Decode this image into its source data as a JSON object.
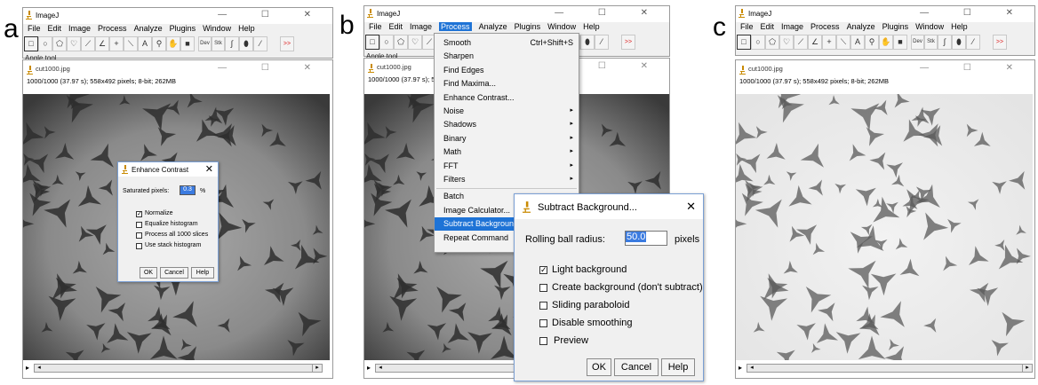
{
  "panel_labels": [
    "a",
    "b",
    "c"
  ],
  "app": {
    "title": "ImageJ",
    "menus": [
      "File",
      "Edit",
      "Image",
      "Process",
      "Analyze",
      "Plugins",
      "Window",
      "Help"
    ],
    "tool_status": "Angle tool",
    "window_controls": [
      "—",
      "☐",
      "✕"
    ],
    "toolbar_icons": [
      "rectangle-icon",
      "oval-icon",
      "polygon-icon",
      "freehand-icon",
      "line-icon",
      "angle-icon",
      "point-icon",
      "wand-icon",
      "text-icon",
      "magnifier-icon",
      "hand-icon",
      "color-picker-icon",
      "dev-icon",
      "stk-icon",
      "brush-icon",
      "dropper-icon",
      "pencil-icon",
      "more-tools-icon"
    ],
    "toolbar_text": {
      "dev": "Dev",
      "stk": "Stk",
      "more": ">>"
    }
  },
  "image_window": {
    "title": "cut1000.jpg",
    "info": "1000/1000 (37.97 s); 558x492 pixels; 8-bit; 262MB",
    "scroll_left": "◂",
    "scroll_right": "▸",
    "play": "▸"
  },
  "enhance_contrast": {
    "title": "Enhance Contrast",
    "saturated_label": "Saturated pixels:",
    "saturated_value": "0.3",
    "unit": "%",
    "options": [
      {
        "label": "Normalize",
        "checked": true
      },
      {
        "label": "Equalize histogram",
        "checked": false
      },
      {
        "label": "Process all 1000 slices",
        "checked": false
      },
      {
        "label": "Use stack histogram",
        "checked": false
      }
    ],
    "buttons": {
      "ok": "OK",
      "cancel": "Cancel",
      "help": "Help"
    }
  },
  "process_menu": {
    "items": [
      {
        "label": "Smooth",
        "shortcut": "Ctrl+Shift+S",
        "submenu": false
      },
      {
        "label": "Sharpen",
        "shortcut": "",
        "submenu": false
      },
      {
        "label": "Find Edges",
        "shortcut": "",
        "submenu": false
      },
      {
        "label": "Find Maxima...",
        "shortcut": "",
        "submenu": false
      },
      {
        "label": "Enhance Contrast...",
        "shortcut": "",
        "submenu": false
      },
      {
        "label": "Noise",
        "shortcut": "",
        "submenu": true
      },
      {
        "label": "Shadows",
        "shortcut": "",
        "submenu": true
      },
      {
        "label": "Binary",
        "shortcut": "",
        "submenu": true
      },
      {
        "label": "Math",
        "shortcut": "",
        "submenu": true
      },
      {
        "label": "FFT",
        "shortcut": "",
        "submenu": true
      },
      {
        "label": "Filters",
        "shortcut": "",
        "submenu": true
      },
      {
        "label": "Batch",
        "shortcut": "",
        "submenu": false
      },
      {
        "label": "Image Calculator...",
        "shortcut": "",
        "submenu": false
      },
      {
        "label": "Subtract Background...",
        "shortcut": "",
        "submenu": false
      },
      {
        "label": "Repeat Command",
        "shortcut": "",
        "submenu": false
      }
    ],
    "highlighted": "Subtract Background...",
    "submenu_arrow": "▸"
  },
  "subtract_background": {
    "title": "Subtract Background...",
    "radius_label": "Rolling ball radius:",
    "radius_value": "50.0",
    "unit": "pixels",
    "options": [
      {
        "label": "Light background",
        "checked": true
      },
      {
        "label": "Create background (don't subtract)",
        "checked": false
      },
      {
        "label": "Sliding paraboloid",
        "checked": false
      },
      {
        "label": "Disable smoothing",
        "checked": false
      },
      {
        "label": "Preview",
        "checked": false
      }
    ],
    "buttons": {
      "ok": "OK",
      "cancel": "Cancel",
      "help": "Help"
    },
    "close": "✕"
  },
  "colors": {
    "menu_highlight": "#1e73d6",
    "dialog_border": "#7a9fd4"
  }
}
